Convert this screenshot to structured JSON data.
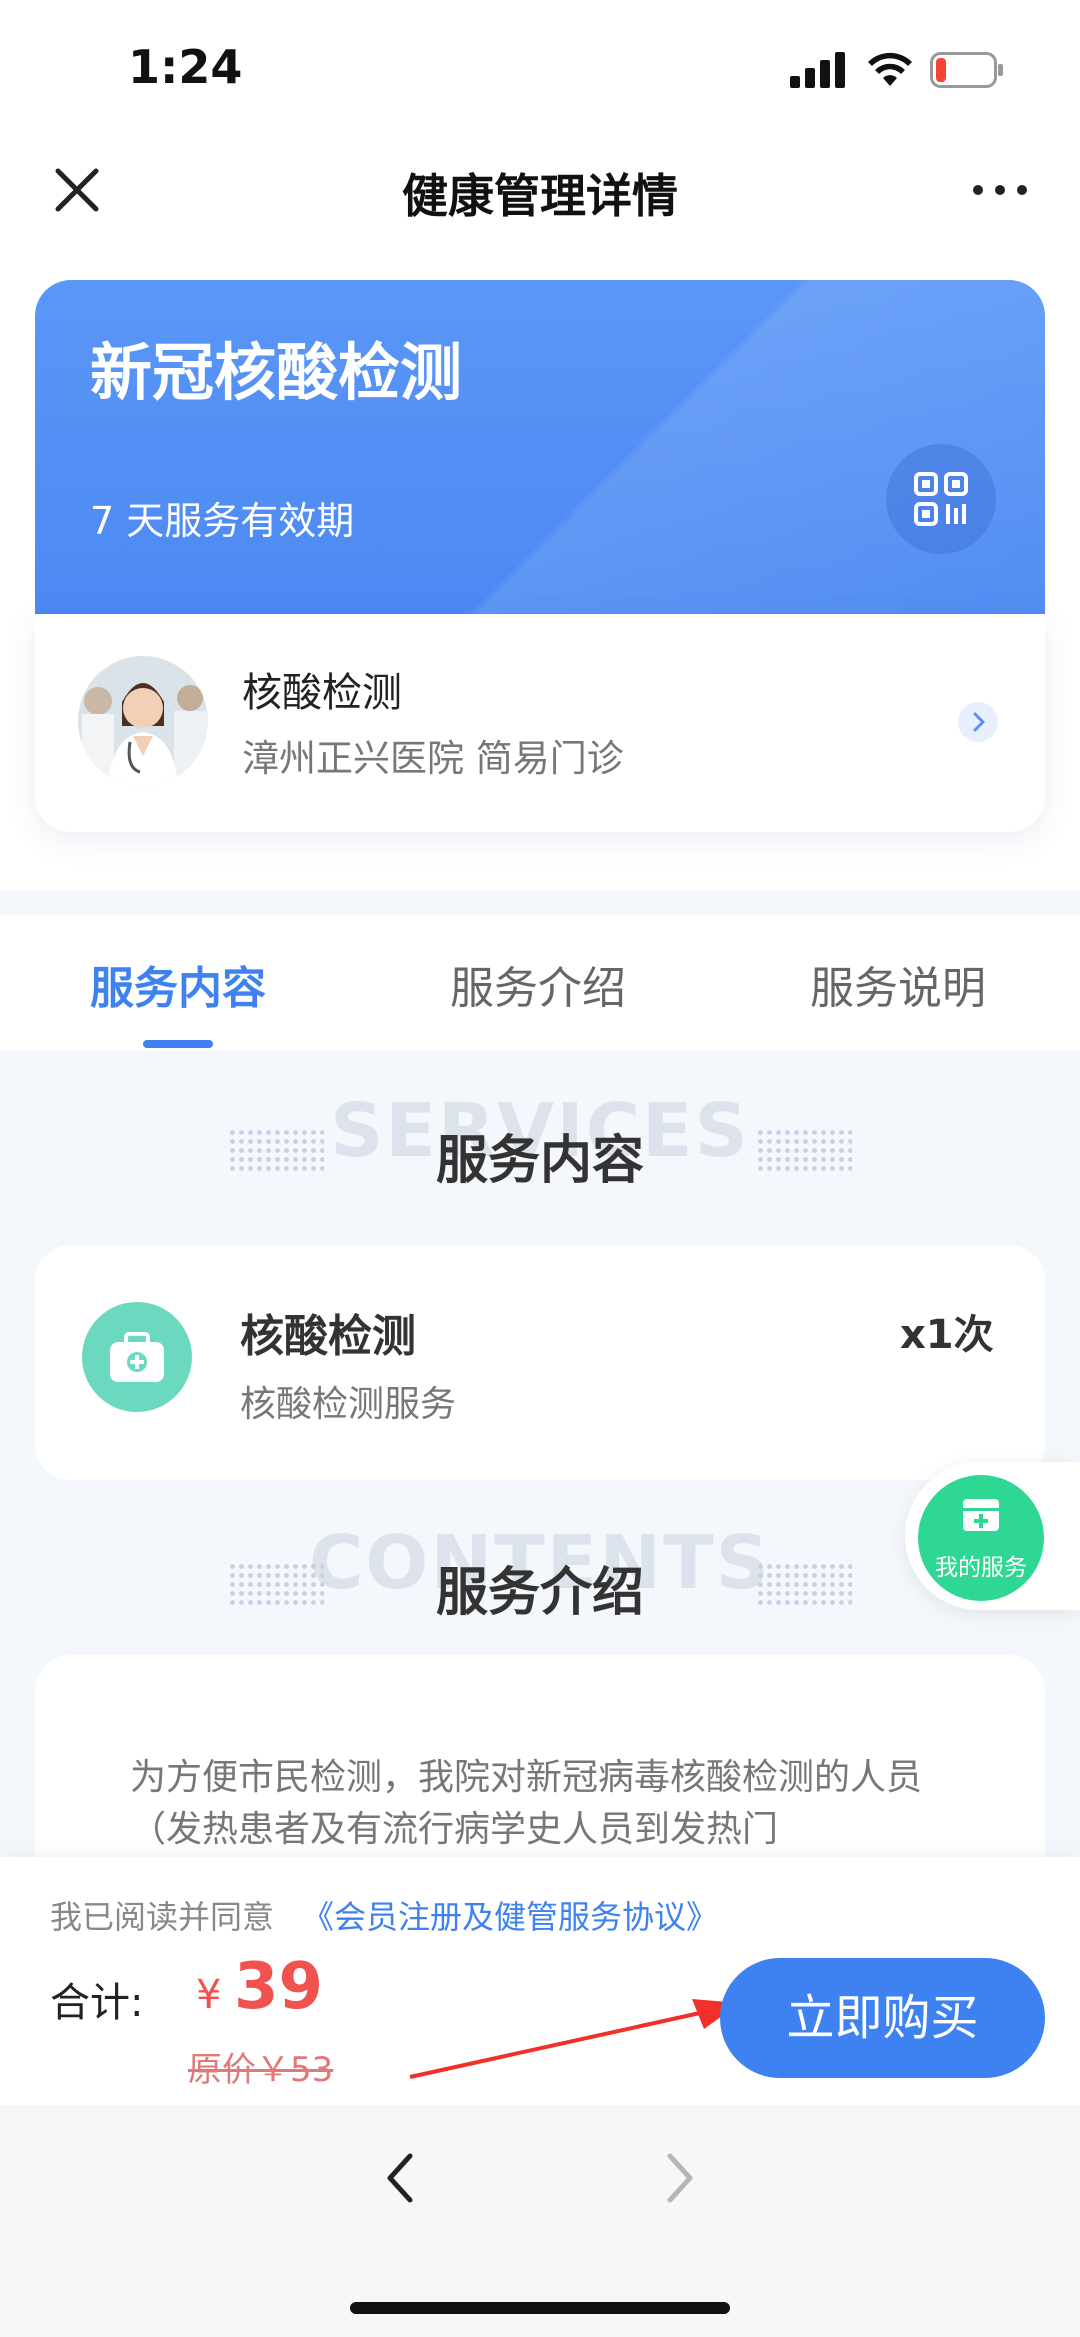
{
  "status": {
    "time": "1:24"
  },
  "nav": {
    "title": "健康管理详情"
  },
  "hero": {
    "title": "新冠核酸检测",
    "validity": "7 天服务有效期"
  },
  "provider": {
    "name": "核酸检测",
    "hospital": "漳州正兴医院 简易门诊"
  },
  "tabs": [
    {
      "label": "服务内容",
      "active": true
    },
    {
      "label": "服务介绍",
      "active": false
    },
    {
      "label": "服务说明",
      "active": false
    }
  ],
  "section_services": {
    "ghost": "SERVICES",
    "title": "服务内容"
  },
  "service_item": {
    "name": "核酸检测",
    "desc": "核酸检测服务",
    "count": "x1次"
  },
  "fab": {
    "label": "我的服务"
  },
  "section_contents": {
    "ghost": "CONTENTS",
    "title": "服务介绍"
  },
  "intro": {
    "text": "为方便市民检测，我院对新冠病毒核酸检测的人员（发热患者及有流行病学史人员到发热门"
  },
  "purchase": {
    "agree_prefix": "我已阅读并同意",
    "agree_link": "《会员注册及健管服务协议》",
    "total_label": "合计:",
    "currency": "¥",
    "price": "39",
    "original_price": "原价￥53",
    "buy_label": "立即购买"
  },
  "colors": {
    "accent": "#3d82f0",
    "price": "#f0524f",
    "fab": "#2ed894",
    "service_icon": "#6ad9bf"
  }
}
